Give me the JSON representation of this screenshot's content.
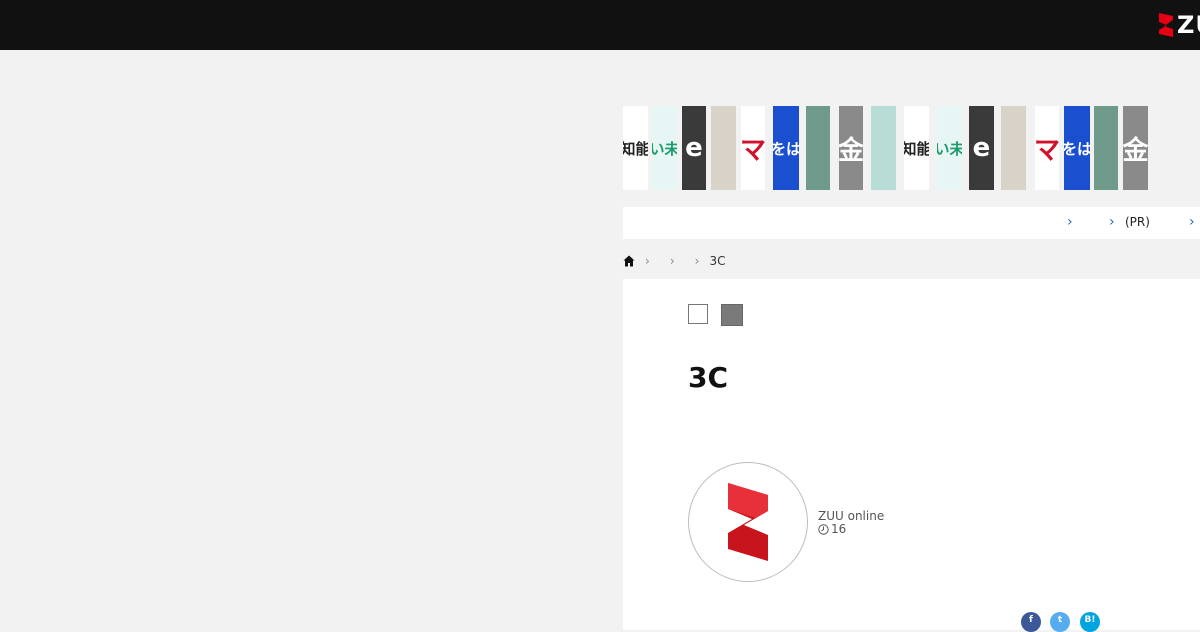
{
  "header": {
    "logo_text": "ZU",
    "logo_icon": "zuu-logo-icon",
    "background": "#111111"
  },
  "banner_strip": {
    "tiles": [
      {
        "label": "知能",
        "bg": "#ffffff",
        "fg": "#222222"
      },
      {
        "label": "い未",
        "bg": "#e6f6f4",
        "fg": "#1d9a6c"
      },
      {
        "label": "e",
        "bg": "#3a3a3a",
        "fg": "#ffffff"
      },
      {
        "label": "",
        "bg": "#d8d2c8",
        "fg": "#222222"
      },
      {
        "label": "マ",
        "bg": "#ffffff",
        "fg": "#d0112b"
      },
      {
        "label": "をは",
        "bg": "#1a4fd0",
        "fg": "#ffffff"
      },
      {
        "label": "",
        "bg": "#6f9a8c",
        "fg": "#ffffff"
      },
      {
        "label": "金",
        "bg": "#8a8a8a",
        "fg": "#ffffff"
      },
      {
        "label": "",
        "bg": "#b8ddd6",
        "fg": "#ffffff"
      },
      {
        "label": "知能",
        "bg": "#ffffff",
        "fg": "#222222"
      },
      {
        "label": "い未",
        "bg": "#e6f6f4",
        "fg": "#1d9a6c"
      },
      {
        "label": "e",
        "bg": "#3a3a3a",
        "fg": "#ffffff"
      },
      {
        "label": "",
        "bg": "#d8d2c8",
        "fg": "#222222"
      },
      {
        "label": "マ",
        "bg": "#ffffff",
        "fg": "#d0112b"
      },
      {
        "label": "をは",
        "bg": "#1a4fd0",
        "fg": "#ffffff"
      },
      {
        "label": "",
        "bg": "#6f9a8c",
        "fg": "#ffffff"
      },
      {
        "label": "金",
        "bg": "#8a8a8a",
        "fg": "#ffffff"
      }
    ]
  },
  "nav": {
    "chevron": "›",
    "pr_label": "(PR)"
  },
  "breadcrumb": {
    "home_icon": "home-icon",
    "separator": "›",
    "current": "3C"
  },
  "article": {
    "title": "3C",
    "author": {
      "name": "ZUU online",
      "time_icon": "clock-icon",
      "time": "16"
    }
  },
  "share": {
    "facebook_label": "f",
    "facebook_color": "#3b5998",
    "twitter_label": "t",
    "twitter_color": "#55acee",
    "hatena_label": "B!",
    "hatena_color": "#00a4de"
  }
}
